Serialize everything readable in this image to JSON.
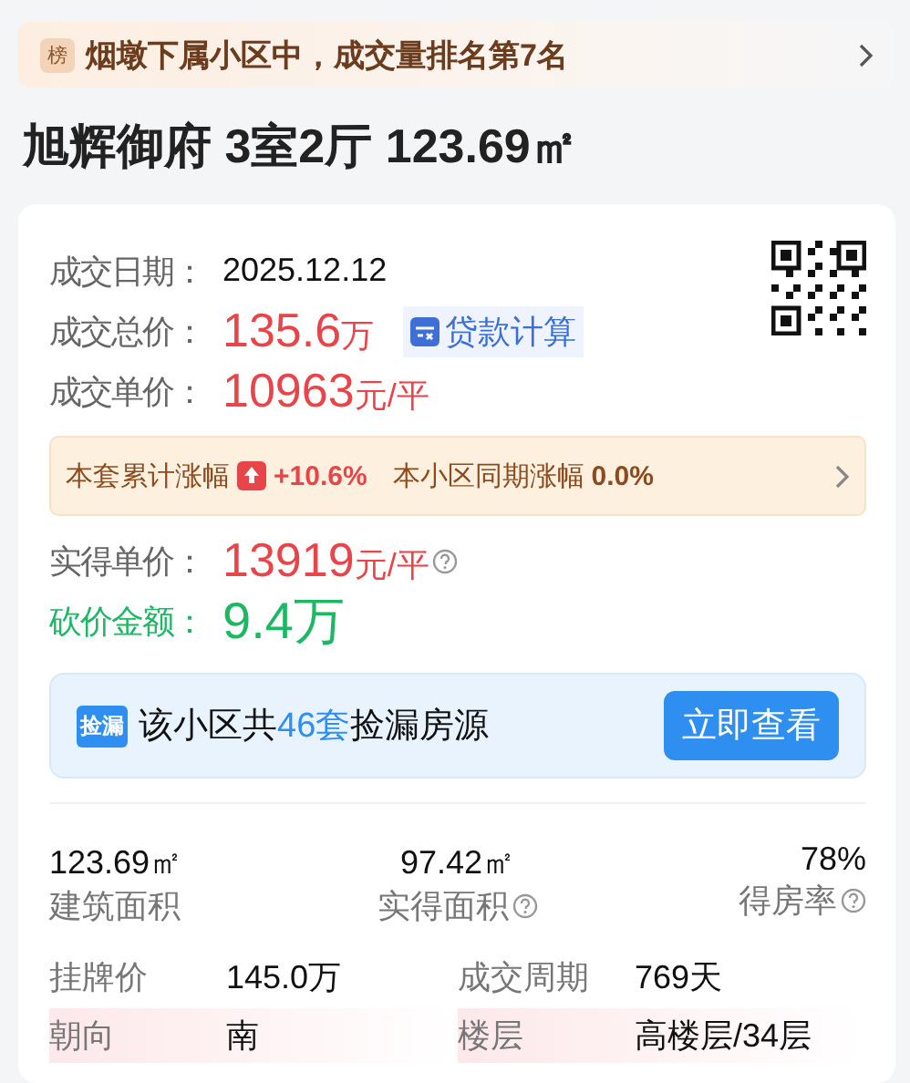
{
  "banner": {
    "badge": "榜",
    "text": "烟墩下属小区中，成交量排名第7名"
  },
  "title": "旭辉御府 3室2厅 123.69㎡",
  "deal_rows": [
    {
      "kind": "plain",
      "label": "成交日期：",
      "value": "2025.12.12"
    },
    {
      "kind": "price",
      "label": "成交总价：",
      "value": "135.6",
      "unit": "万",
      "action": "贷款计算"
    },
    {
      "kind": "price",
      "label": "成交单价：",
      "value": "10963",
      "unit": "元/平"
    }
  ],
  "rise": {
    "label": "本套累计涨幅",
    "value": "+10.6%",
    "compare_label": "本小区同期涨幅",
    "compare_value": "0.0%"
  },
  "extra_rows": [
    {
      "kind": "price",
      "label": "实得单价：",
      "value": "13919",
      "unit": "元/平",
      "help": true
    },
    {
      "kind": "discount",
      "label": "砍价金额：",
      "value": "9.4万",
      "help": false
    }
  ],
  "pickup": {
    "badge": "捡漏",
    "prefix": "该小区共",
    "count": "46套",
    "suffix": "捡漏房源",
    "button": "立即查看"
  },
  "stats": [
    {
      "value": "123.69㎡",
      "label": "建筑面积",
      "help": false
    },
    {
      "value": "97.42㎡",
      "label": "实得面积",
      "help": true
    },
    {
      "value": "78%",
      "label": "得房率",
      "help": true
    }
  ],
  "attributes": [
    {
      "label": "挂牌价",
      "value": "145.0万",
      "highlighted": false
    },
    {
      "label": "成交周期",
      "value": "769天",
      "highlighted": false
    },
    {
      "label": "朝向",
      "value": "南",
      "highlighted": true
    },
    {
      "label": "楼层",
      "value": "高楼层/34层",
      "highlighted": true
    }
  ]
}
